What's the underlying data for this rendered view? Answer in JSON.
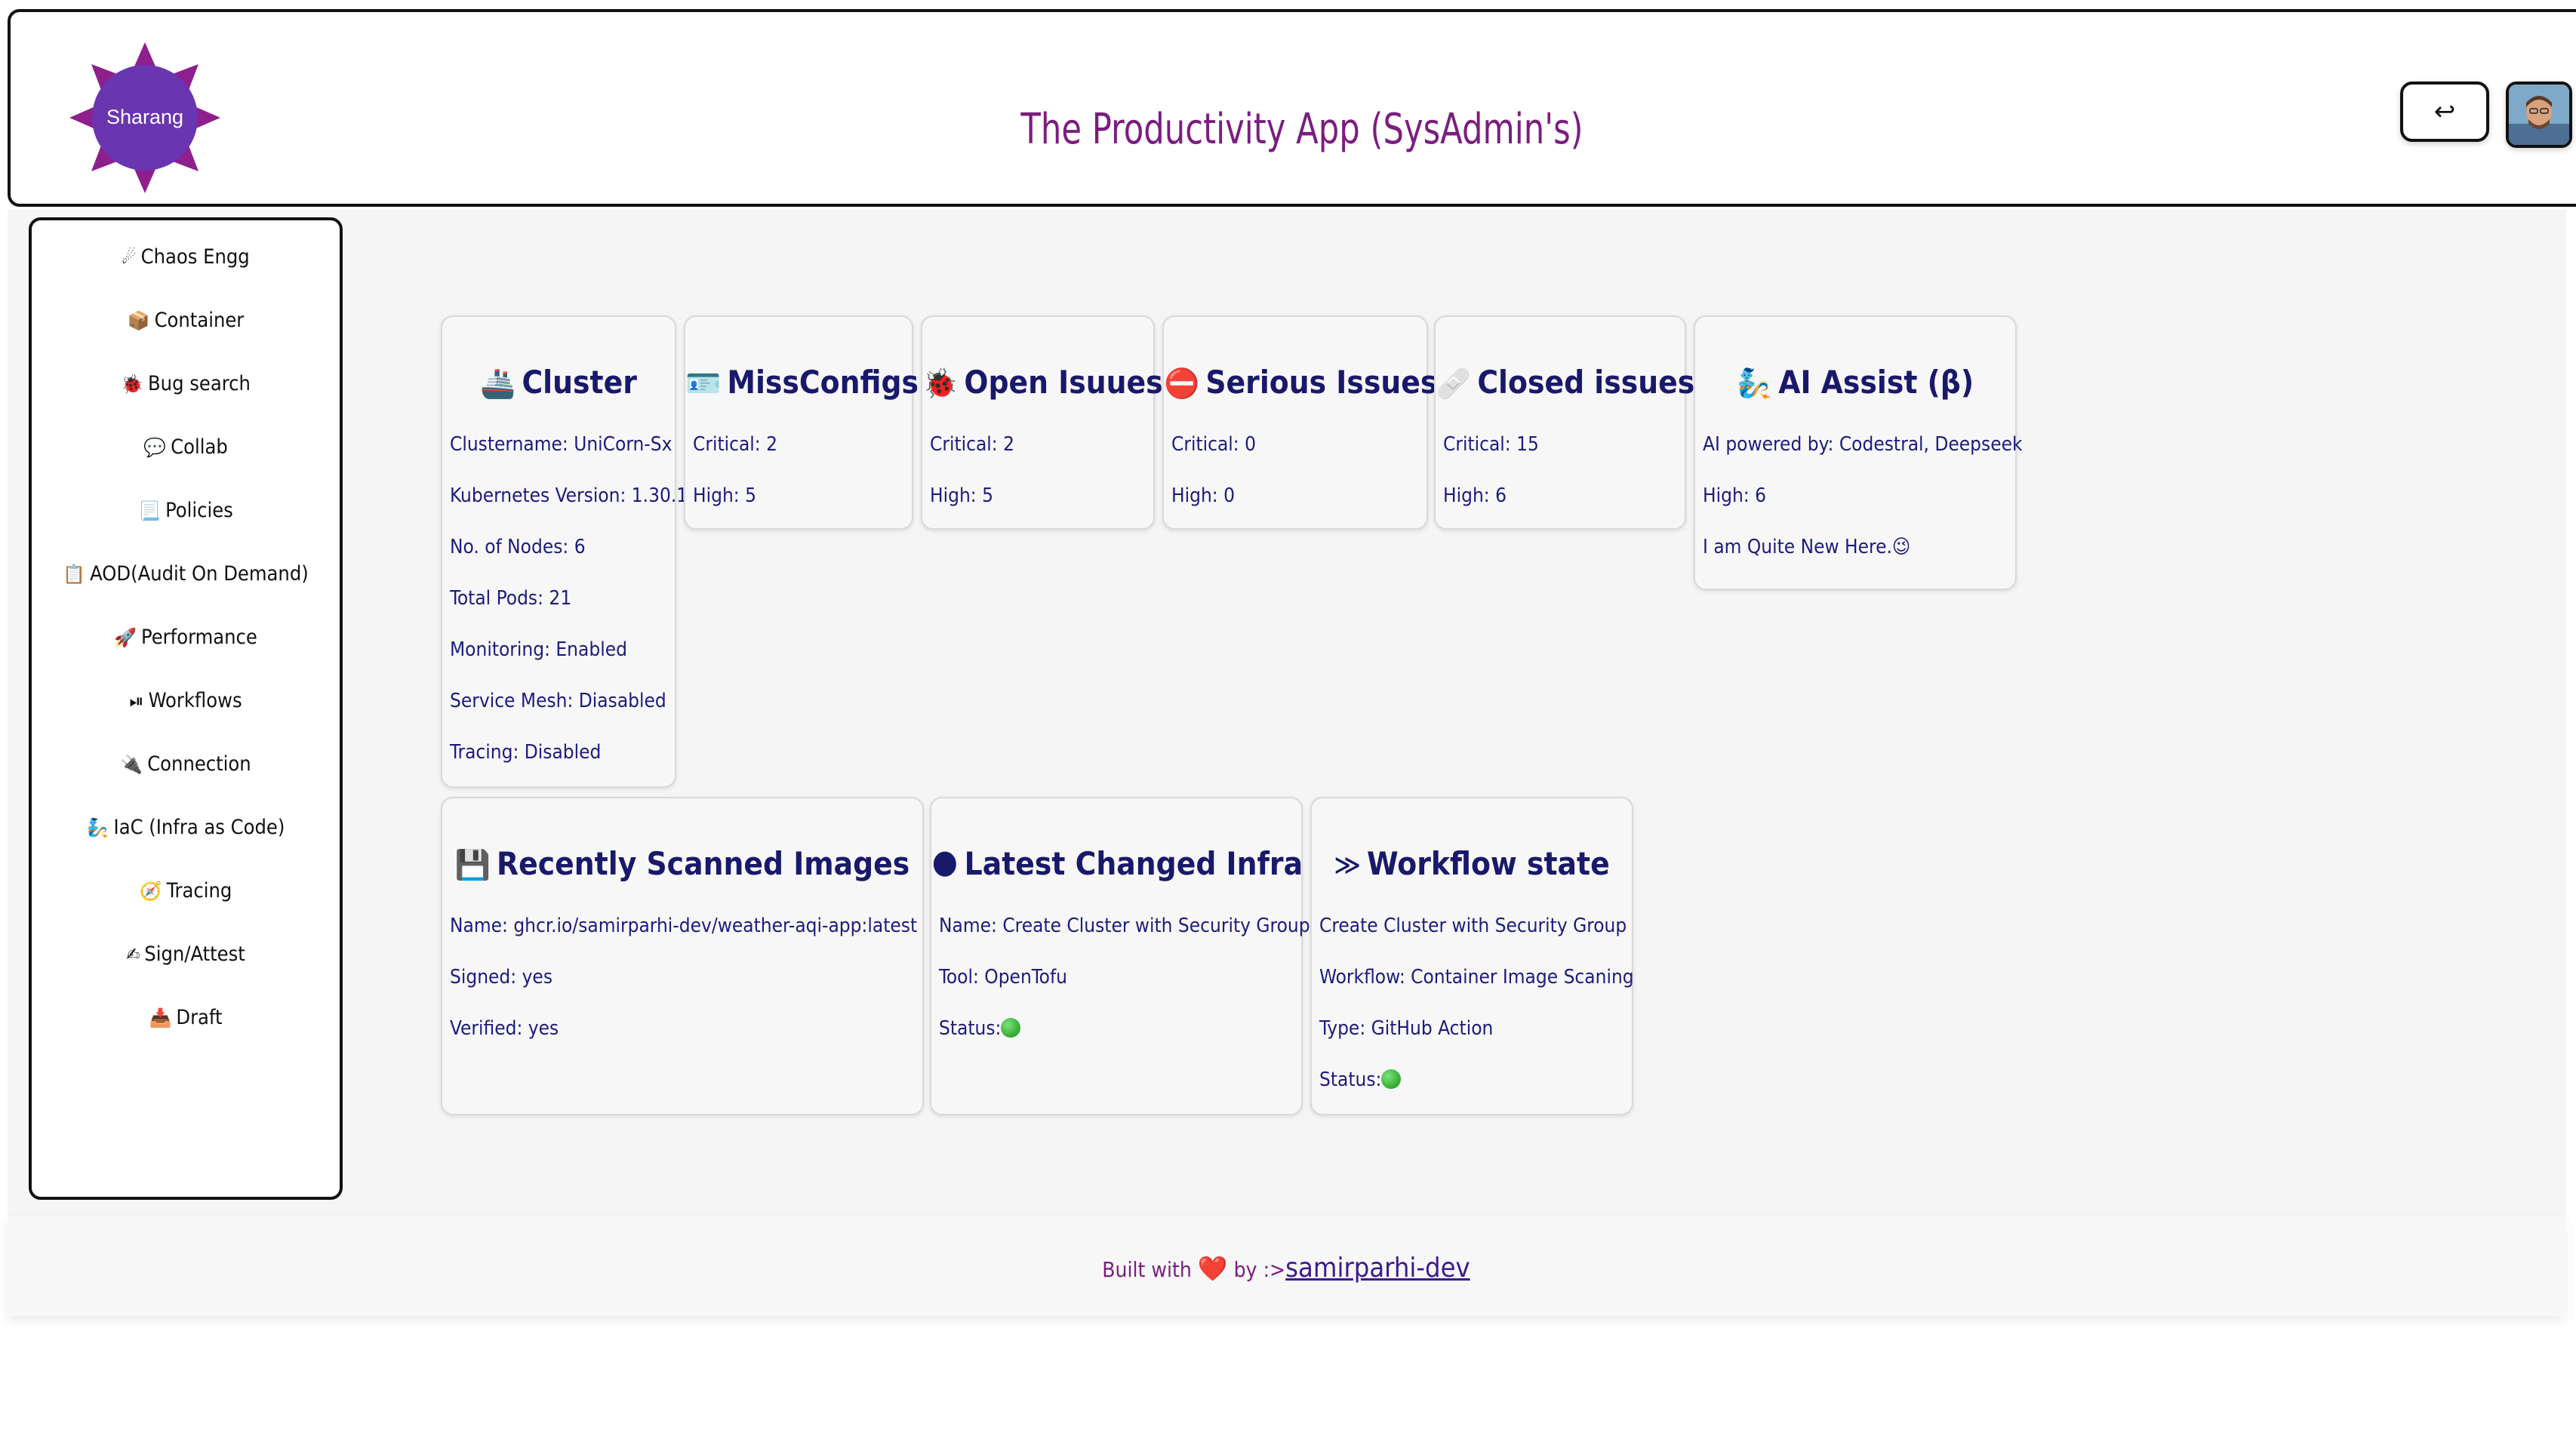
{
  "header": {
    "logo_text": "Sharang",
    "title": "The Productivity App (SysAdmin's)",
    "logout_icon": "↩"
  },
  "sidebar": {
    "items": [
      {
        "icon": "☄",
        "label": "Chaos Engg"
      },
      {
        "icon": "📦",
        "label": "Container"
      },
      {
        "icon": "🐞",
        "label": "Bug search"
      },
      {
        "icon": "💬",
        "label": "Collab"
      },
      {
        "icon": "📃",
        "label": "Policies"
      },
      {
        "icon": "📋",
        "label": "AOD(Audit On Demand)"
      },
      {
        "icon": "🚀",
        "label": "Performance"
      },
      {
        "icon": "⏯",
        "label": "Workflows"
      },
      {
        "icon": "🔌",
        "label": "Connection"
      },
      {
        "icon": "🧞",
        "label": "IaC (Infra as Code)"
      },
      {
        "icon": "🧭",
        "label": "Tracing"
      },
      {
        "icon": "✍",
        "label": "Sign/Attest"
      },
      {
        "icon": "📥",
        "label": "Draft"
      }
    ]
  },
  "cards": {
    "cluster": {
      "icon": "🚢",
      "title": "Cluster",
      "lines": [
        "Clustername: UniCorn-Sx",
        "Kubernetes Version: 1.30.1",
        "No. of Nodes: 6",
        "Total Pods: 21",
        "Monitoring: Enabled",
        "Service Mesh: Diasabled",
        "Tracing: Disabled"
      ]
    },
    "missconfigs": {
      "icon": "🪪",
      "title": "MissConfigs",
      "lines": [
        "Critical: 2",
        "High: 5"
      ]
    },
    "open_issues": {
      "icon": "🐞",
      "title": "Open Isuues",
      "lines": [
        "Critical: 2",
        "High: 5"
      ]
    },
    "serious_issues": {
      "icon": "⛔",
      "title": "Serious Issues",
      "lines": [
        "Critical: 0",
        "High: 0"
      ]
    },
    "closed_issues": {
      "icon": "🩹",
      "title": "Closed issues",
      "lines": [
        "Critical: 15",
        "High: 6"
      ]
    },
    "ai_assist": {
      "icon": "🧞",
      "title": "AI Assist (β)",
      "lines": [
        "AI powered by: Codestral, Deepseek",
        "High: 6",
        "I am Quite New Here.😉"
      ]
    },
    "scanned_images": {
      "icon": "💾",
      "title": "Recently Scanned Images",
      "lines": [
        "Name: ghcr.io/samirparhi-dev/weather-aqi-app:latest",
        "Signed: yes",
        "Verified: yes"
      ]
    },
    "changed_infra": {
      "icon": "🌑",
      "title": "Latest Changed Infra",
      "lines": [
        "Name: Create Cluster with Security Group",
        "Tool: OpenTofu",
        "Status:"
      ]
    },
    "workflow_state": {
      "icon": "≫",
      "title": "Workflow state",
      "lines": [
        "Create Cluster with Security Group",
        "Workflow: Container Image Scaning",
        "Type: GitHub Action",
        "Status:"
      ]
    }
  },
  "footer": {
    "prefix": "Built with",
    "heart": "❤️",
    "middle": "by :>",
    "link": "samirparhi-dev"
  },
  "colors": {
    "title_purple": "#7b1d7f",
    "card_title_navy": "#19196b",
    "card_text": "#1c1c7c",
    "logo_purple": "#6b2aa6",
    "logo_magenta": "#8e1f8c"
  }
}
